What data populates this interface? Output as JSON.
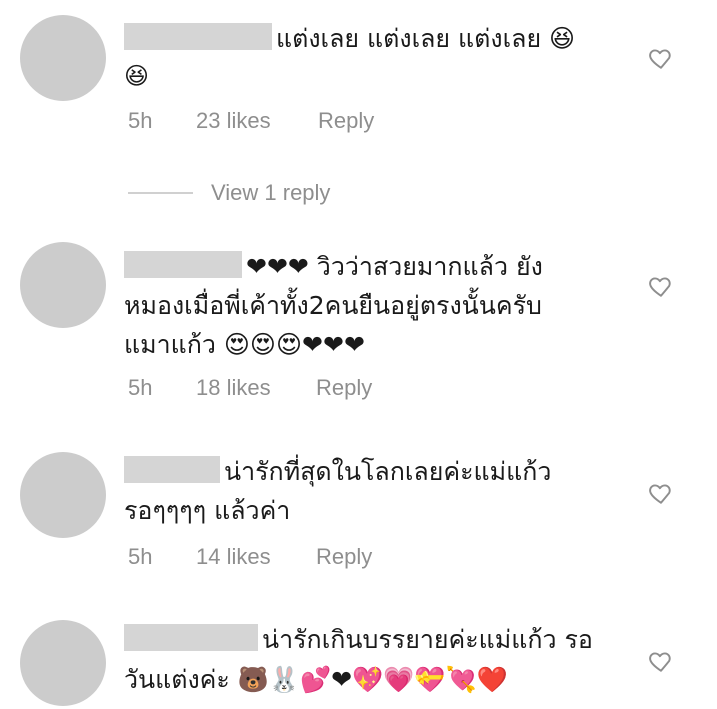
{
  "comments": [
    {
      "line1": "แต่งเลย แต่งเลย แต่งเลย 😆",
      "line2": "😆",
      "time": "5h",
      "likes": "23 likes",
      "reply": "Reply"
    },
    {
      "line1": "❤❤❤ วิวว่าสวยมากแล้ว ยัง",
      "line2": "หมองเมื่อพี่เค้าทั้ง2คนยืนอยู่ตรงนั้นครับ",
      "line3": "แมาแก้ว 😍😍😍❤❤❤",
      "time": "5h",
      "likes": "18 likes",
      "reply": "Reply"
    },
    {
      "line1": "น่ารักที่สุดในโลกเลยค่ะแม่แก้ว",
      "line2": "รอๆๆๆๆ แล้วค่า",
      "time": "5h",
      "likes": "14 likes",
      "reply": "Reply"
    },
    {
      "line1": "น่ารักเกินบรรยายค่ะแม่แก้ว รอ",
      "line2": "วันแต่งค่ะ 🐻🐰💕❤💖💗💝💘❤️"
    }
  ],
  "view_replies": "View 1 reply",
  "icons": {
    "like": "heart-outline-icon"
  },
  "colors": {
    "avatar": "#cccccc",
    "meta_text": "#8e8e8e",
    "mask": "#d5d5d5"
  }
}
